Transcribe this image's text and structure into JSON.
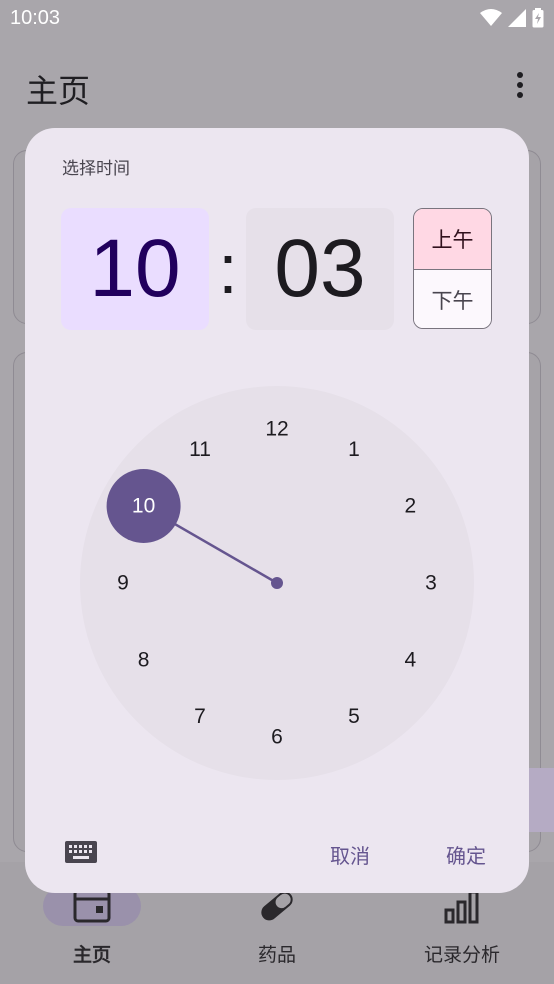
{
  "status_bar": {
    "time": "10:03"
  },
  "app_bar": {
    "title": "主页"
  },
  "bottom_nav": {
    "items": [
      {
        "label": "主页",
        "icon": "calendar-icon",
        "active": true
      },
      {
        "label": "药品",
        "icon": "pill-icon",
        "active": false
      },
      {
        "label": "记录分析",
        "icon": "bar-chart-icon",
        "active": false
      }
    ]
  },
  "dialog": {
    "title": "选择时间",
    "hour": "10",
    "separator": ":",
    "minute": "03",
    "am_label": "上午",
    "pm_label": "下午",
    "selected_period": "am",
    "clock": {
      "numbers": [
        "12",
        "1",
        "2",
        "3",
        "4",
        "5",
        "6",
        "7",
        "8",
        "9",
        "10",
        "11"
      ],
      "selected": "10"
    },
    "cancel_label": "取消",
    "ok_label": "确定"
  },
  "colors": {
    "accent": "#65558f",
    "hour_box": "#eaddff",
    "am_selected": "#ffd8e4",
    "dialog_bg": "#ece6f0",
    "clock_face": "#e6e0e9"
  }
}
